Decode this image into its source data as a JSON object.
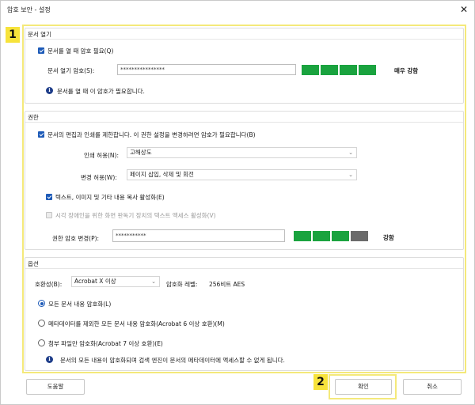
{
  "window": {
    "title": "암호 보안 - 설정",
    "close_glyph": "✕"
  },
  "callouts": {
    "one": "1",
    "two": "2"
  },
  "open_group": {
    "title": "문서 열기",
    "require_label": "문서를 열 때 암호 필요(Q)",
    "require_checked": true,
    "password_label": "문서 열기 암호(S):",
    "password_value": "****************",
    "strength_label": "매우 강함",
    "strength_level": 5,
    "strength_max": 5,
    "info_text": "문서를 열 때 이 암호가 필요합니다."
  },
  "permissions_group": {
    "title": "권한",
    "restrict_label": "문서의 편집과 인쇄를 제한합니다. 이 권한 설정을 변경하려면 암호가 필요합니다(B)",
    "restrict_checked": true,
    "print_label": "인쇄 허용(N):",
    "print_value": "고해상도",
    "change_label": "변경 허용(W):",
    "change_value": "페이지 삽입, 삭제 및 회전",
    "copy_label": "텍스트, 이미지 및 기타 내용 복사 활성화(E)",
    "copy_checked": true,
    "access_label": "시각 장애인을 위한 화면 판독기 장치의 텍스트 액세스 활성화(V)",
    "access_checked": false,
    "perm_password_label": "권한 암호 변경(P):",
    "perm_password_value": "***********",
    "strength_label": "강함",
    "strength_level": 3,
    "strength_max": 4
  },
  "options_group": {
    "title": "옵션",
    "compat_label": "호환성(B):",
    "compat_value": "Acrobat X 이상",
    "enc_level_label": "암호화 레벨:",
    "enc_level_value": "256비트 AES",
    "radios": [
      {
        "label": "모든 문서 내용 암호화(L)",
        "selected": true
      },
      {
        "label": "메타데이터를 제외한 모든 문서 내용 암호화(Acrobat 6 이상 호환)(M)",
        "selected": false
      },
      {
        "label": "첨부 파일만 암호화(Acrobat 7 이상 호환)(E)",
        "selected": false
      }
    ],
    "info_text": "문서의 모든 내용이 암호화되며 검색 엔진이 문서의 메타데이터에 액세스할 수 없게 됩니다."
  },
  "buttons": {
    "help": "도움말",
    "ok": "확인",
    "cancel": "취소"
  },
  "icons": {
    "info": "info-icon",
    "close": "close-icon",
    "dropdown": "chevron-down-icon"
  },
  "colors": {
    "strength_green": "#1aa33f",
    "strength_gray": "#6b6b6b",
    "accent": "#1e5bb8",
    "callout": "#f7e33b"
  }
}
